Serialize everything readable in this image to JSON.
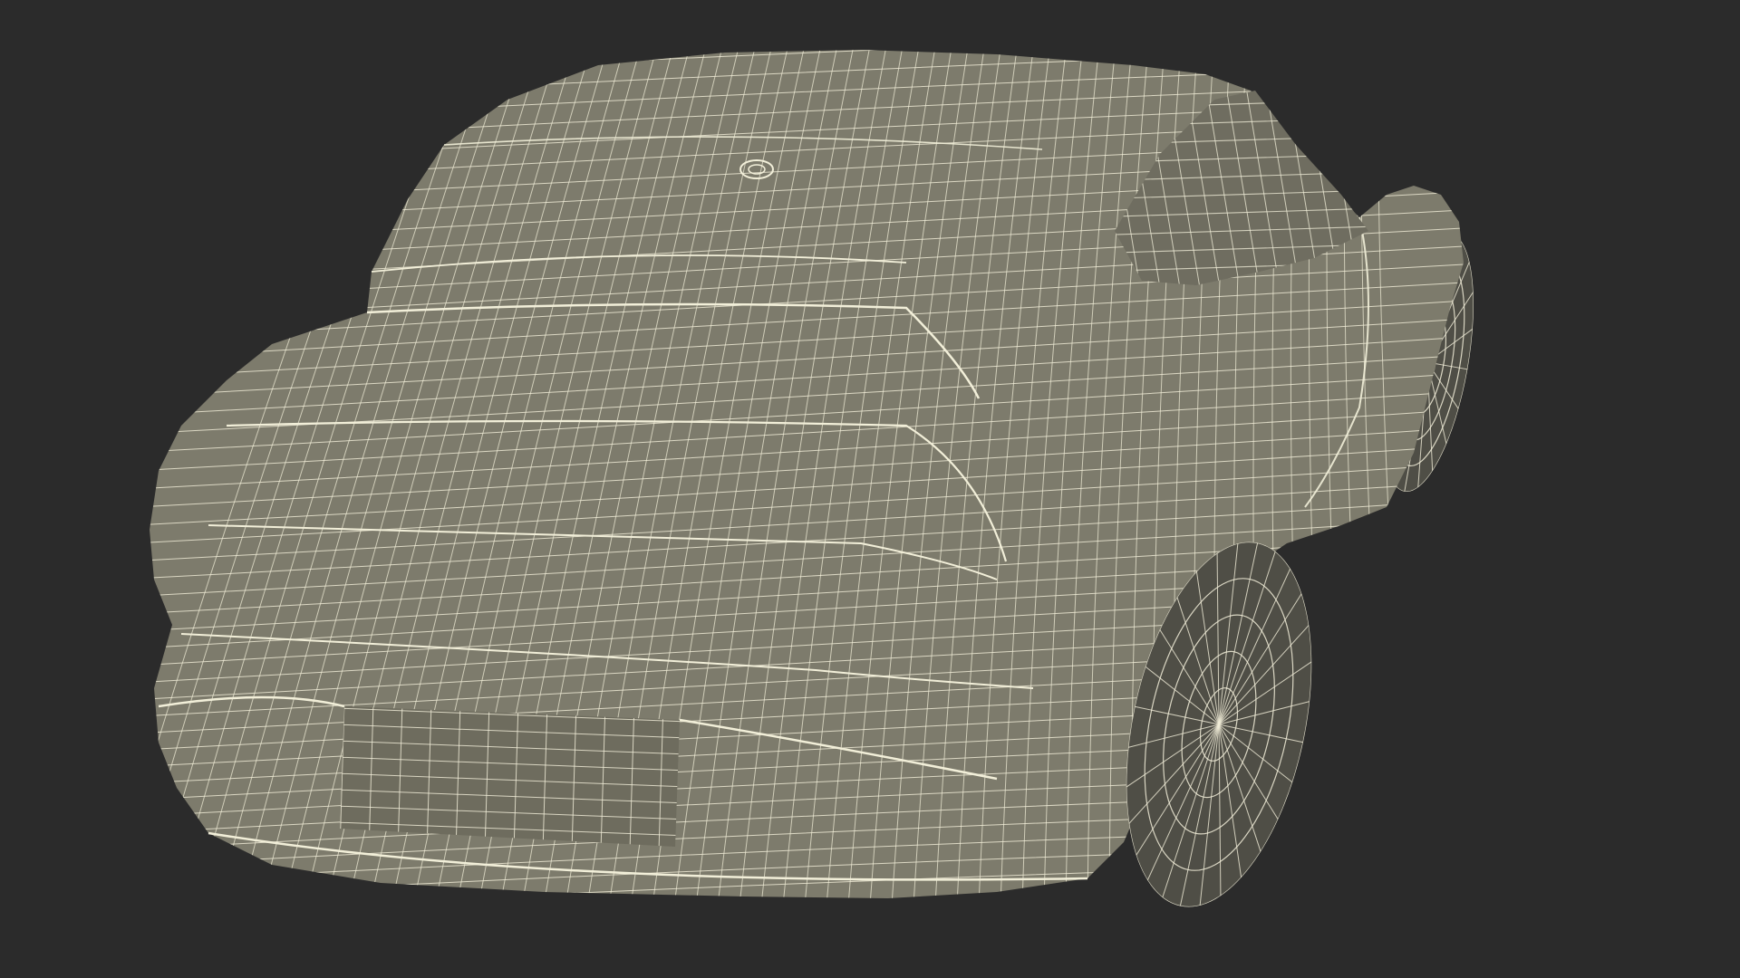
{
  "scene": {
    "subject": "wireframe-car-rear-three-quarter",
    "background_color": "#2b2b2b",
    "surface_color": "#7d7b6c",
    "surface_shadow_color": "#5f5e52",
    "wire_color": "#f2efd9",
    "tire_color": "#4f4e46"
  }
}
